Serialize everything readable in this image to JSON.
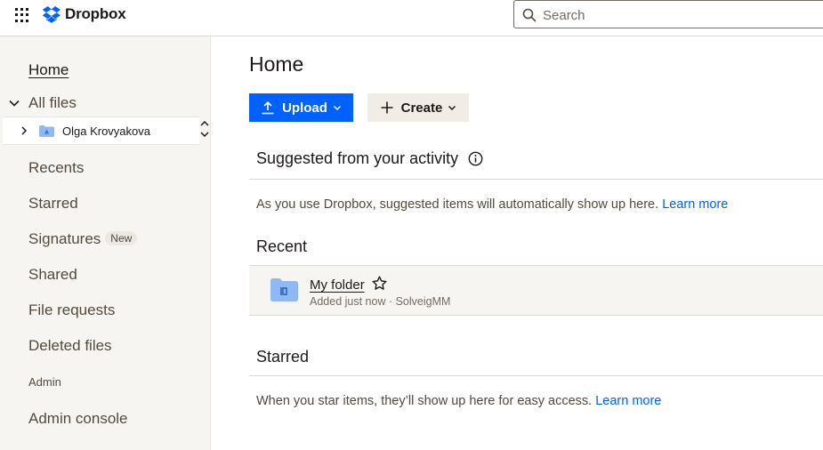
{
  "app": {
    "brand": "Dropbox",
    "brand_color": "#0061fe"
  },
  "search": {
    "placeholder": "Search"
  },
  "sidebar": {
    "home": "Home",
    "all_files": "All files",
    "tree_item": "Olga Krovyakova",
    "items": [
      {
        "label": "Recents"
      },
      {
        "label": "Starred"
      },
      {
        "label": "Signatures",
        "badge": "New"
      },
      {
        "label": "Shared"
      },
      {
        "label": "File requests"
      },
      {
        "label": "Deleted files"
      }
    ],
    "section_admin": "Admin",
    "admin_console": "Admin console"
  },
  "main": {
    "title": "Home",
    "upload_label": "Upload",
    "create_label": "Create",
    "suggested": {
      "heading": "Suggested from your activity",
      "text": "As you use Dropbox, suggested items will automatically show up here.",
      "link": "Learn more"
    },
    "recent": {
      "heading": "Recent",
      "items": [
        {
          "name": "My folder",
          "meta": "Added just now · SolveigMM"
        }
      ]
    },
    "starred": {
      "heading": "Starred",
      "text": "When you star items, they’ll show up here for easy access.",
      "link": "Learn more"
    }
  }
}
